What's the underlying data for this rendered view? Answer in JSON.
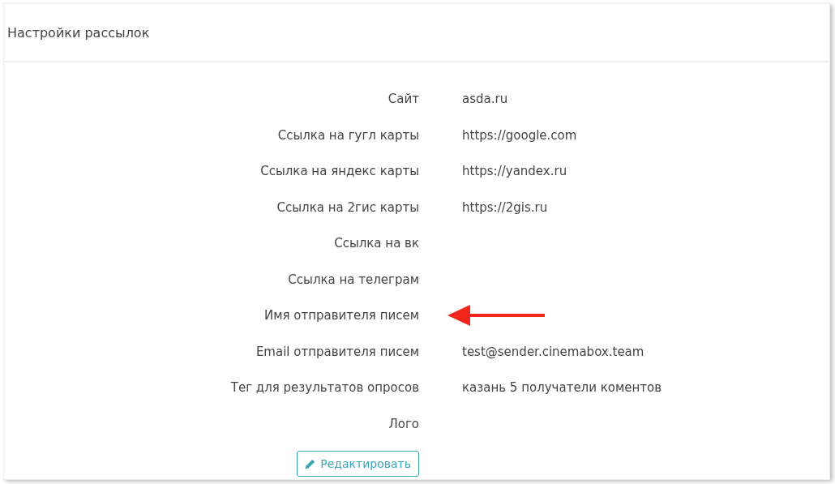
{
  "panel": {
    "title": "Настройки рассылок"
  },
  "fields": [
    {
      "label": "Сайт",
      "value": "asda.ru"
    },
    {
      "label": "Ссылка на гугл карты",
      "value": "https://google.com"
    },
    {
      "label": "Ссылка на яндекс карты",
      "value": "https://yandex.ru"
    },
    {
      "label": "Ссылка на 2гис карты",
      "value": "https://2gis.ru"
    },
    {
      "label": "Ссылка на вк"
    },
    {
      "label": "Ссылка на телеграм"
    },
    {
      "label": "Имя отправителя писем",
      "highlighted": true
    },
    {
      "label": "Email отправителя писем",
      "value": "test@sender.cinemabox.team"
    },
    {
      "label": "Тег для результатов опросов",
      "value": "казань 5 получатели коментов"
    },
    {
      "label": "Лого"
    }
  ],
  "edit_button": {
    "label": "Редактировать"
  }
}
